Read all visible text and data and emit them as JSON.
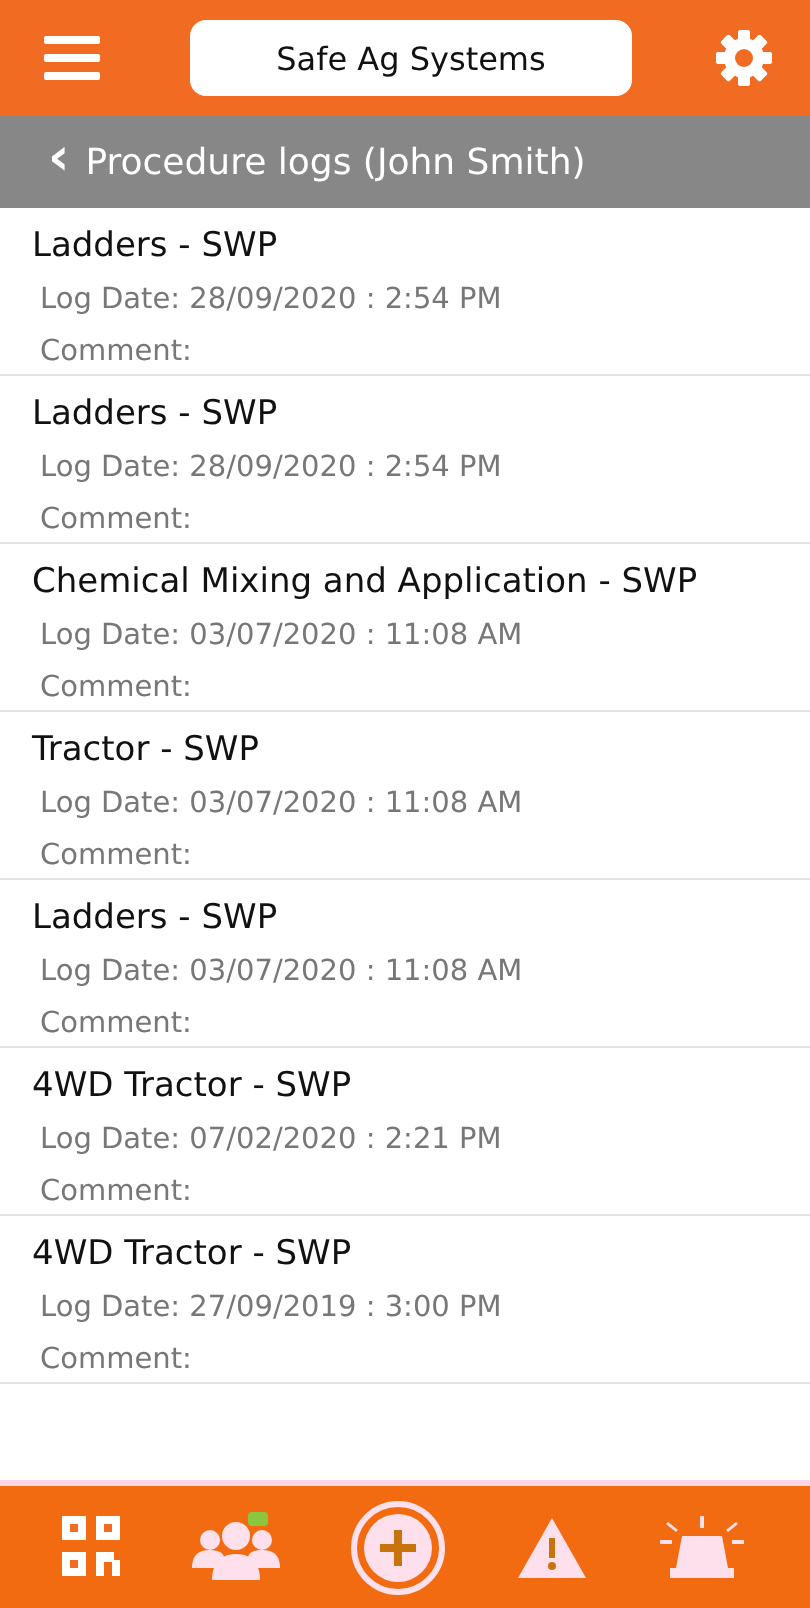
{
  "header": {
    "title": "Safe Ag Systems"
  },
  "subheader": {
    "back_icon": "‹",
    "title": "Procedure logs (John Smith)"
  },
  "logs": [
    {
      "title": "Ladders - SWP",
      "log_date": "Log Date: 28/09/2020 : 2:54 PM",
      "comment": "Comment:"
    },
    {
      "title": "Ladders - SWP",
      "log_date": "Log Date: 28/09/2020 : 2:54 PM",
      "comment": "Comment:"
    },
    {
      "title": "Chemical Mixing and Application - SWP",
      "log_date": "Log Date: 03/07/2020 : 11:08 AM",
      "comment": "Comment:"
    },
    {
      "title": "Tractor - SWP",
      "log_date": "Log Date: 03/07/2020 : 11:08 AM",
      "comment": "Comment:"
    },
    {
      "title": "Ladders - SWP",
      "log_date": "Log Date: 03/07/2020 : 11:08 AM",
      "comment": "Comment:"
    },
    {
      "title": "4WD Tractor - SWP",
      "log_date": "Log Date: 07/02/2020 : 2:21 PM",
      "comment": "Comment:"
    },
    {
      "title": "4WD Tractor - SWP",
      "log_date": "Log Date: 27/09/2019 : 3:00 PM",
      "comment": "Comment:"
    }
  ],
  "bottom_nav": [
    {
      "kind": "qr"
    },
    {
      "kind": "people"
    },
    {
      "kind": "add"
    },
    {
      "kind": "warning"
    },
    {
      "kind": "alarm"
    }
  ]
}
